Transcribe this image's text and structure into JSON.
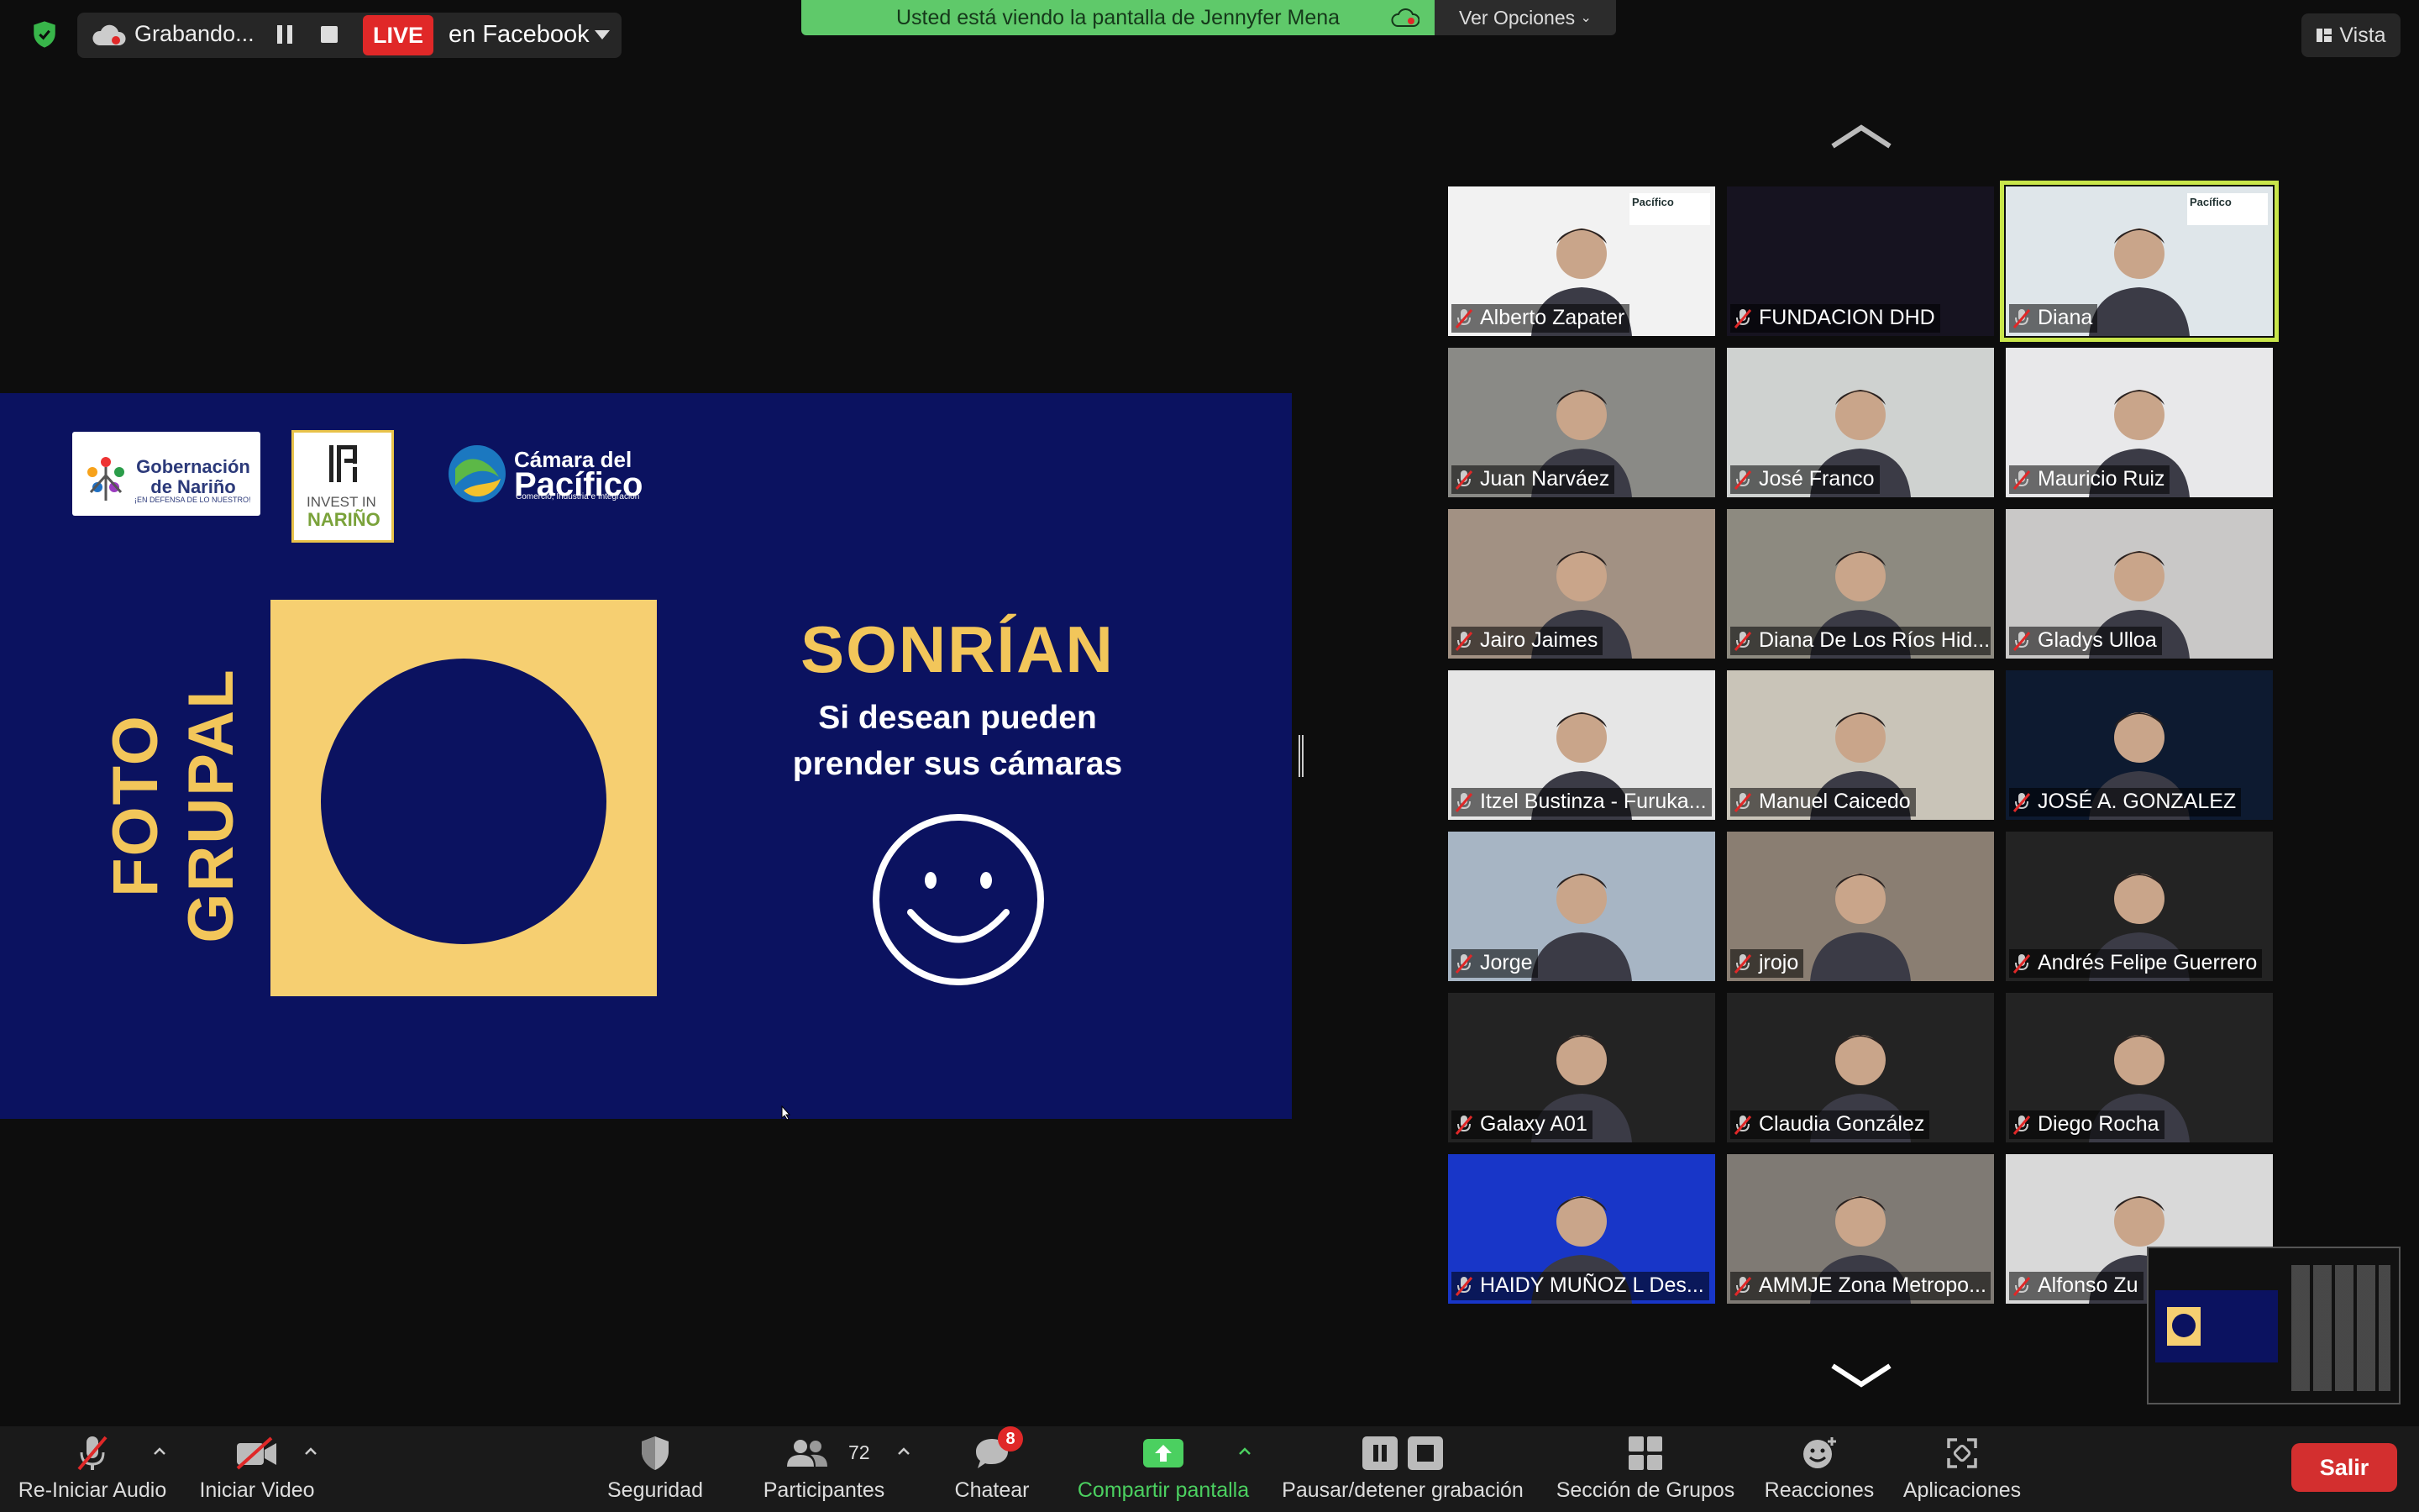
{
  "topbar": {
    "recording_label": "Grabando...",
    "live_label": "LIVE",
    "live_target": "en Facebook",
    "banner_text": "Usted está viendo la pantalla de Jennyfer Mena",
    "options_label": "Ver Opciones",
    "view_label": "Vista"
  },
  "slide": {
    "logo_gob_title": "Gobernación de Nariño",
    "logo_gob_subtitle": "¡EN DEFENSA DE LO NUESTRO!",
    "logo_invest_line1": "INVEST IN",
    "logo_invest_line2": "NARIÑO",
    "logo_camara_line1": "Cámara del",
    "logo_camara_line2": "Pacífico",
    "logo_camara_line3": "Comercio, Industria e Integración",
    "vertical_title": "FOTO GRUPAL",
    "heading": "SONRÍAN",
    "subtitle_line1": "Si desean pueden",
    "subtitle_line2": "prender sus cámaras"
  },
  "gallery": {
    "participants": [
      {
        "name": "Alberto Zapater",
        "bg": "#f2f2f2",
        "logo": true
      },
      {
        "name": "FUNDACION DHD",
        "bg": "#161320"
      },
      {
        "name": "Diana",
        "bg": "#dfe6ea",
        "active": true,
        "logo": true
      },
      {
        "name": "Juan Narváez",
        "bg": "#8a8a86"
      },
      {
        "name": "José Franco",
        "bg": "#cfd2d0"
      },
      {
        "name": "Mauricio Ruiz",
        "bg": "#e8e8ea"
      },
      {
        "name": "Jairo Jaimes",
        "bg": "#a29183"
      },
      {
        "name": "Diana De Los Ríos Hid...",
        "bg": "#8d8a80"
      },
      {
        "name": "Gladys Ulloa",
        "bg": "#c9c8c7"
      },
      {
        "name": "Itzel Bustinza - Furuka...",
        "bg": "#e6e6e6"
      },
      {
        "name": "Manuel Caicedo",
        "bg": "#c9c4b8"
      },
      {
        "name": "JOSÉ A. GONZALEZ",
        "bg": "#0d1a30"
      },
      {
        "name": "Jorge",
        "bg": "#a7b5c4"
      },
      {
        "name": "jrojo",
        "bg": "#8a7e72"
      },
      {
        "name": "Andrés Felipe Guerrero",
        "bg": "#232323"
      },
      {
        "name": "Galaxy A01",
        "bg": "#232323"
      },
      {
        "name": "Claudia González",
        "bg": "#232323"
      },
      {
        "name": "Diego Rocha",
        "bg": "#232323"
      },
      {
        "name": "HAIDY MUÑOZ L Des...",
        "bg": "#1836c8"
      },
      {
        "name": "AMMJE Zona Metropo...",
        "bg": "#7f7a74"
      },
      {
        "name": "Alfonso Zu",
        "bg": "#d9d9d9"
      }
    ]
  },
  "toolbar": {
    "audio_label": "Re-Iniciar Audio",
    "video_label": "Iniciar Video",
    "security_label": "Seguridad",
    "participants_label": "Participantes",
    "participants_count": "72",
    "chat_label": "Chatear",
    "chat_badge": "8",
    "share_label": "Compartir pantalla",
    "pause_label": "Pausar/detener grabación",
    "groups_label": "Sección de Grupos",
    "reactions_label": "Reacciones",
    "apps_label": "Aplicaciones",
    "leave_label": "Salir"
  },
  "colors": {
    "banner": "#5fc96a",
    "live": "#e02828",
    "share": "#4bd060",
    "slide_bg": "#0b1260",
    "slide_accent": "#f2c65a",
    "leave": "#d32f2f",
    "active_border": "#c9e64a"
  },
  "icons": [
    "shield-icon",
    "cloud-icon",
    "pause-icon",
    "stop-icon",
    "caret-down-icon",
    "grid-icon",
    "chevron-up-icon",
    "chevron-down-icon",
    "muted-mic-icon",
    "video-off-icon",
    "participants-icon",
    "chat-icon",
    "share-icon",
    "record-icon",
    "groups-icon",
    "reaction-icon",
    "apps-icon",
    "smiley-icon"
  ]
}
